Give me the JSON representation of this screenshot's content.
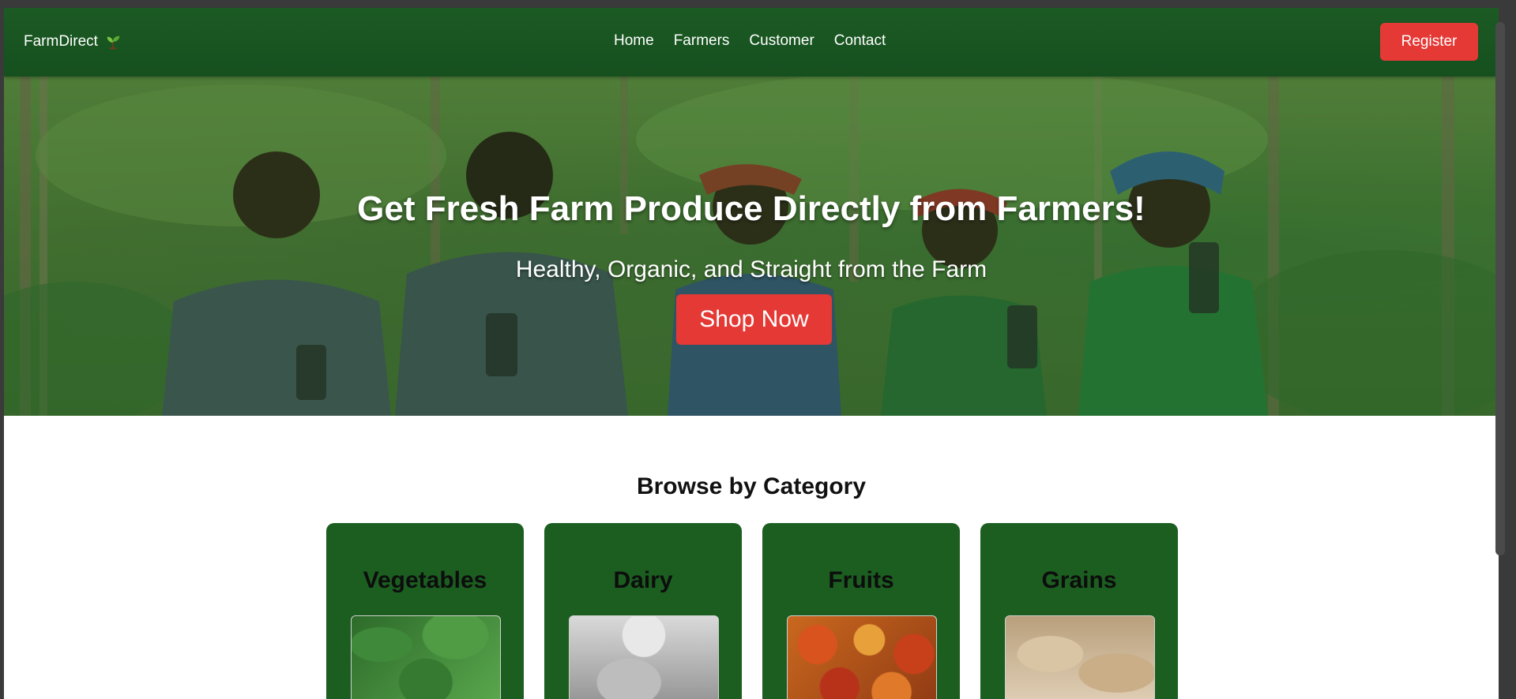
{
  "nav": {
    "brand": "FarmDirect",
    "brand_icon": "seedling-icon",
    "links": [
      "Home",
      "Farmers",
      "Customer",
      "Contact"
    ],
    "register_label": "Register"
  },
  "hero": {
    "title": "Get Fresh Farm Produce Directly from Farmers!",
    "subtitle": "Healthy, Organic, and Straight from the Farm",
    "cta_label": "Shop Now"
  },
  "categories": {
    "title": "Browse by Category",
    "items": [
      {
        "label": "Vegetables",
        "image": "vegetables-photo"
      },
      {
        "label": "Dairy",
        "image": "dairy-photo"
      },
      {
        "label": "Fruits",
        "image": "fruits-photo"
      },
      {
        "label": "Grains",
        "image": "grains-photo"
      }
    ]
  },
  "colors": {
    "nav_bg": "#15501e",
    "accent": "#e53935",
    "card_bg": "#1b5e20"
  }
}
